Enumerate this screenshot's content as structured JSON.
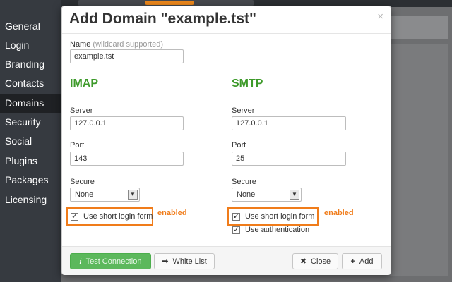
{
  "sidebar": {
    "items": [
      {
        "label": "General"
      },
      {
        "label": "Login"
      },
      {
        "label": "Branding"
      },
      {
        "label": "Contacts"
      },
      {
        "label": "Domains",
        "active": true
      },
      {
        "label": "Security"
      },
      {
        "label": "Social"
      },
      {
        "label": "Plugins"
      },
      {
        "label": "Packages"
      },
      {
        "label": "Licensing"
      }
    ]
  },
  "modal": {
    "title": "Add Domain \"example.tst\"",
    "close_glyph": "×",
    "name_label": "Name",
    "name_hint": "(wildcard supported)",
    "name_value": "example.tst",
    "imap": {
      "title": "IMAP",
      "server_label": "Server",
      "server_value": "127.0.0.1",
      "port_label": "Port",
      "port_value": "143",
      "secure_label": "Secure",
      "secure_value": "None",
      "short_login_label": "Use short login form",
      "short_login_checked": true,
      "annotation": "enabled"
    },
    "smtp": {
      "title": "SMTP",
      "server_label": "Server",
      "server_value": "127.0.0.1",
      "port_label": "Port",
      "port_value": "25",
      "secure_label": "Secure",
      "secure_value": "None",
      "short_login_label": "Use short login form",
      "short_login_checked": true,
      "use_auth_label": "Use authentication",
      "use_auth_checked": true,
      "annotation": "enabled"
    },
    "footer": {
      "test_connection": "Test Connection",
      "test_icon": "i",
      "white_list": "White List",
      "white_list_icon": "➡",
      "close": "Close",
      "close_icon": "✖",
      "add": "Add",
      "add_icon": "+"
    }
  },
  "colors": {
    "accent_green": "#3d9a2a",
    "button_green": "#5cb85c",
    "annotation_orange": "#f07c1a",
    "sidebar_active": "#1f2124"
  }
}
